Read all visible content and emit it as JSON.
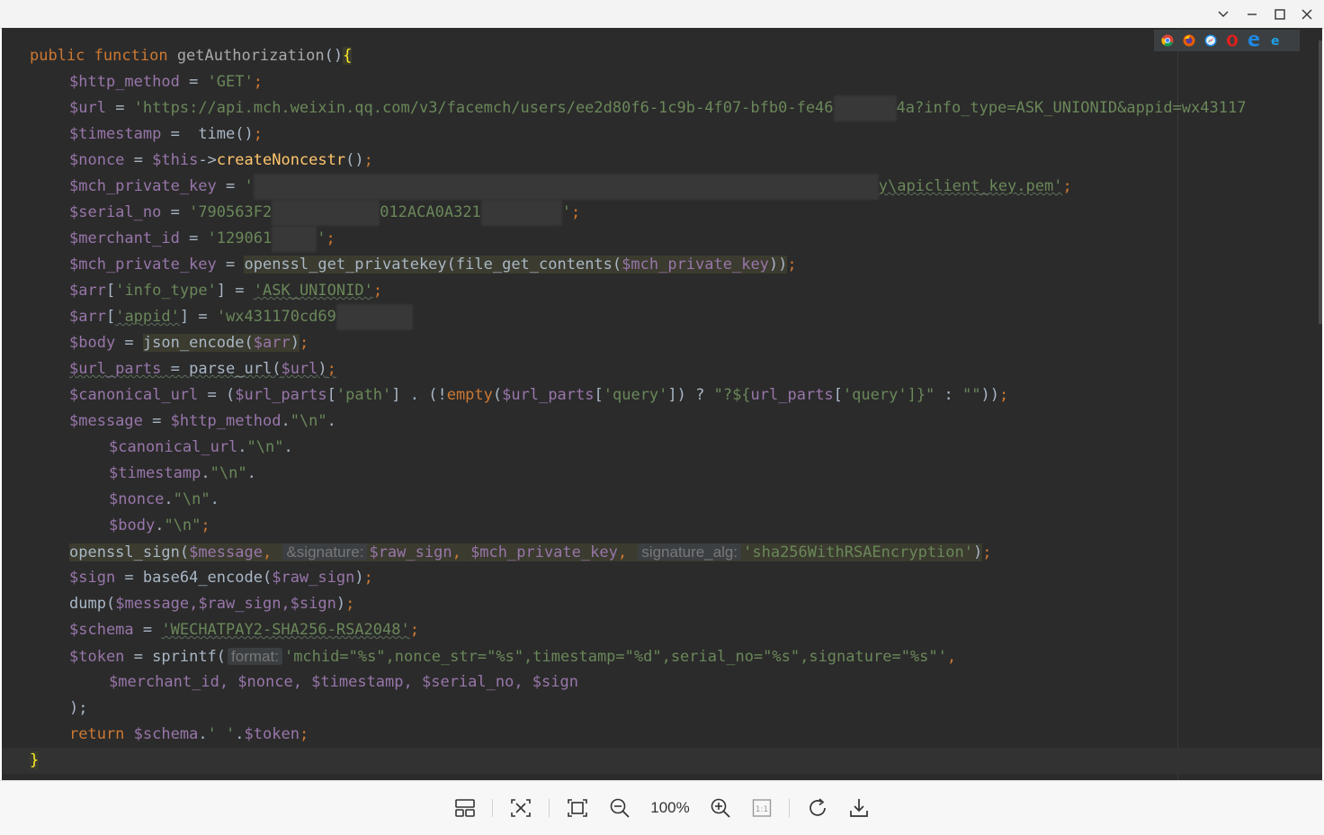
{
  "window": {
    "controls": [
      "chevron-down",
      "minimize",
      "maximize",
      "close"
    ]
  },
  "browser_icons": [
    "chrome-icon",
    "firefox-icon",
    "safari-icon",
    "opera-icon",
    "edge-icon",
    "ie-icon"
  ],
  "code": {
    "l1": {
      "kw1": "public",
      "kw2": "function",
      "name": "getAuthorization",
      "paren": "()",
      "brace": "{"
    },
    "l2": {
      "var": "$http_method",
      "eq": " = ",
      "str": "'GET'",
      "end": ";"
    },
    "l3": {
      "var": "$url",
      "eq": " = ",
      "str_a": "'https://api.mch.weixin.qq.com/v3/facemch/users/ee2d80f6-1c9b-4f07-bfb0-fe46",
      "str_b": "4a?info_type=ASK_UNIONID&appid=wx43117"
    },
    "l4": {
      "var": "$timestamp",
      "eq": " =  ",
      "fn": "time",
      "call": "()",
      "end": ";"
    },
    "l5": {
      "var": "$nonce",
      "eq": " = ",
      "this": "$this",
      "arrow": "->",
      "fn": "createNoncestr",
      "call": "()",
      "end": ";"
    },
    "l6": {
      "var": "$mch_private_key",
      "eq": " = ",
      "str_a": "'",
      "str_b": "y\\apiclient_key.pem'",
      "end": ";"
    },
    "l7": {
      "var": "$serial_no",
      "eq": " = ",
      "str_a": "'790563F2",
      "str_b": "012ACA0A321",
      "str_c": "'",
      "end": ";"
    },
    "l8": {
      "var": "$merchant_id",
      "eq": " = ",
      "str_a": "'129061",
      "str_b": "'",
      "end": ";"
    },
    "l9": {
      "var": "$mch_private_key",
      "eq": " = ",
      "fn1": "openssl_get_privatekey",
      "p1": "(",
      "fn2": "file_get_contents",
      "p2": "(",
      "arg": "$mch_private_key",
      "p3": "))",
      "end": ";"
    },
    "l10": {
      "var": "$arr",
      "b1": "[",
      "key": "'info_type'",
      "b2": "]",
      "eq": " = ",
      "str": "'ASK_UNIONID'",
      "end": ";"
    },
    "l11": {
      "var": "$arr",
      "b1": "[",
      "key": "'appid'",
      "b2": "]",
      "eq": " = ",
      "str": "'wx431170cd69"
    },
    "l12": {
      "var": "$body",
      "eq": " = ",
      "fn": "json_encode",
      "p1": "(",
      "arg": "$arr",
      "p2": ")",
      "end": ";"
    },
    "l13": {
      "var": "$url_parts",
      "eq": " = ",
      "fn": "parse_url",
      "p1": "(",
      "arg": "$url",
      "p2": ")",
      "end": ";"
    },
    "l14": {
      "var": "$canonical_url",
      "eq": " = (",
      "v2": "$url_parts",
      "b1": "[",
      "k1": "'path'",
      "b2": "] . (!",
      "fn": "empty",
      "p1": "(",
      "v3": "$url_parts",
      "b3": "[",
      "k2": "'query'",
      "b4": "]) ? ",
      "s1": "\"?${",
      "v4": "url_parts",
      "b5": "[",
      "k3": "'query'",
      "b6": "]}\"",
      "tail": " : ",
      "s2": "\"\"",
      "close": "))",
      "end": ";"
    },
    "l15": {
      "var": "$message",
      "eq": " = ",
      "v2": "$http_method",
      "dot": ".",
      "str": "\"\\n\"",
      "tail": "."
    },
    "l16": {
      "var": "$canonical_url",
      "dot": ".",
      "str": "\"\\n\"",
      "tail": "."
    },
    "l17": {
      "var": "$timestamp",
      "dot": ".",
      "str": "\"\\n\"",
      "tail": "."
    },
    "l18": {
      "var": "$nonce",
      "dot": ".",
      "str": "\"\\n\"",
      "tail": "."
    },
    "l19": {
      "var": "$body",
      "dot": ".",
      "str": "\"\\n\"",
      "end": ";"
    },
    "l20": {
      "fn": "openssl_sign",
      "p1": "(",
      "a1": "$message",
      "c1": ", ",
      "h1": "&signature:",
      "a2": "$raw_sign",
      "c2": ", ",
      "a3": "$mch_private_key",
      "c3": ", ",
      "h2": "signature_alg:",
      "s": "'sha256WithRSAEncryption'",
      "p2": ")",
      "end": ";"
    },
    "l21": {
      "var": "$sign",
      "eq": " = ",
      "fn": "base64_encode",
      "p1": "(",
      "arg": "$raw_sign",
      "p2": ")",
      "end": ";"
    },
    "l22": {
      "fn": "dump",
      "p1": "(",
      "args": "$message,$raw_sign,$sign",
      "p2": ")",
      "end": ";"
    },
    "l23": {
      "var": "$schema",
      "eq": " = ",
      "str": "'WECHATPAY2-SHA256-RSA2048'",
      "end": ";"
    },
    "l24": {
      "var": "$token",
      "eq": " = ",
      "fn": "sprintf",
      "p1": "(",
      "hint": "format:",
      "str": "'mchid=\"%s\",nonce_str=\"%s\",timestamp=\"%d\",serial_no=\"%s\",signature=\"%s\"'",
      "end": ","
    },
    "l25": {
      "args": "$merchant_id, $nonce, $timestamp, $serial_no, $sign"
    },
    "l26": {
      "close": ");"
    },
    "l27": {
      "kw": "return",
      "sp": " ",
      "var": "$schema",
      "dot": ".",
      "str": "' '",
      "dot2": ".",
      "var2": "$token",
      "end": ";"
    },
    "l28": {
      "brace": "}"
    }
  },
  "toolbar": {
    "zoom": "100%"
  }
}
